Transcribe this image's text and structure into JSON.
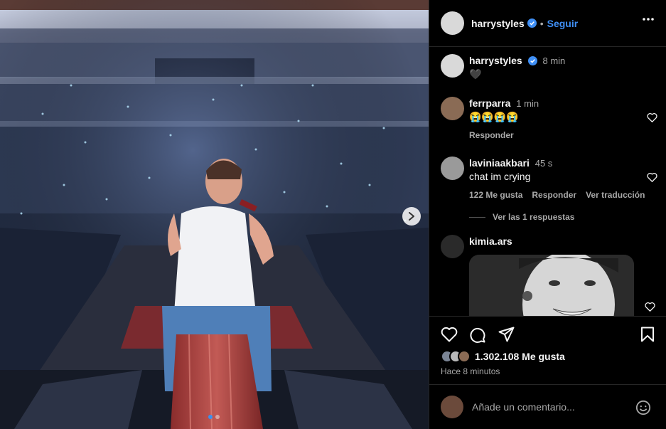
{
  "post": {
    "author": "harrystyles",
    "follow_label": "Seguir",
    "separator": "•",
    "caption_time": "8 min",
    "caption_text": "🖤",
    "likes_text": "1.302.108 Me gusta",
    "time_ago": "Hace 8 minutos"
  },
  "comments": [
    {
      "user": "ferrparra",
      "time": "1 min",
      "text": "😭😭😭😭",
      "reply_label": "Responder"
    },
    {
      "user": "laviniaakbari",
      "time": "45 s",
      "text": "chat im crying",
      "likes_label": "122 Me gusta",
      "reply_label": "Responder",
      "translate_label": "Ver traducción"
    },
    {
      "user": "kimia.ars"
    }
  ],
  "replies_label": "Ver las 1 respuestas",
  "add_comment_placeholder": "Añade un comentario...",
  "colors": {
    "accent": "#3f8ff5",
    "panel_bg": "#000000",
    "muted": "#a8a8a8"
  },
  "icons": [
    "verified-icon",
    "more-icon",
    "next-arrow-icon",
    "heart-icon",
    "comment-icon",
    "share-icon",
    "save-icon",
    "emoji-icon"
  ]
}
